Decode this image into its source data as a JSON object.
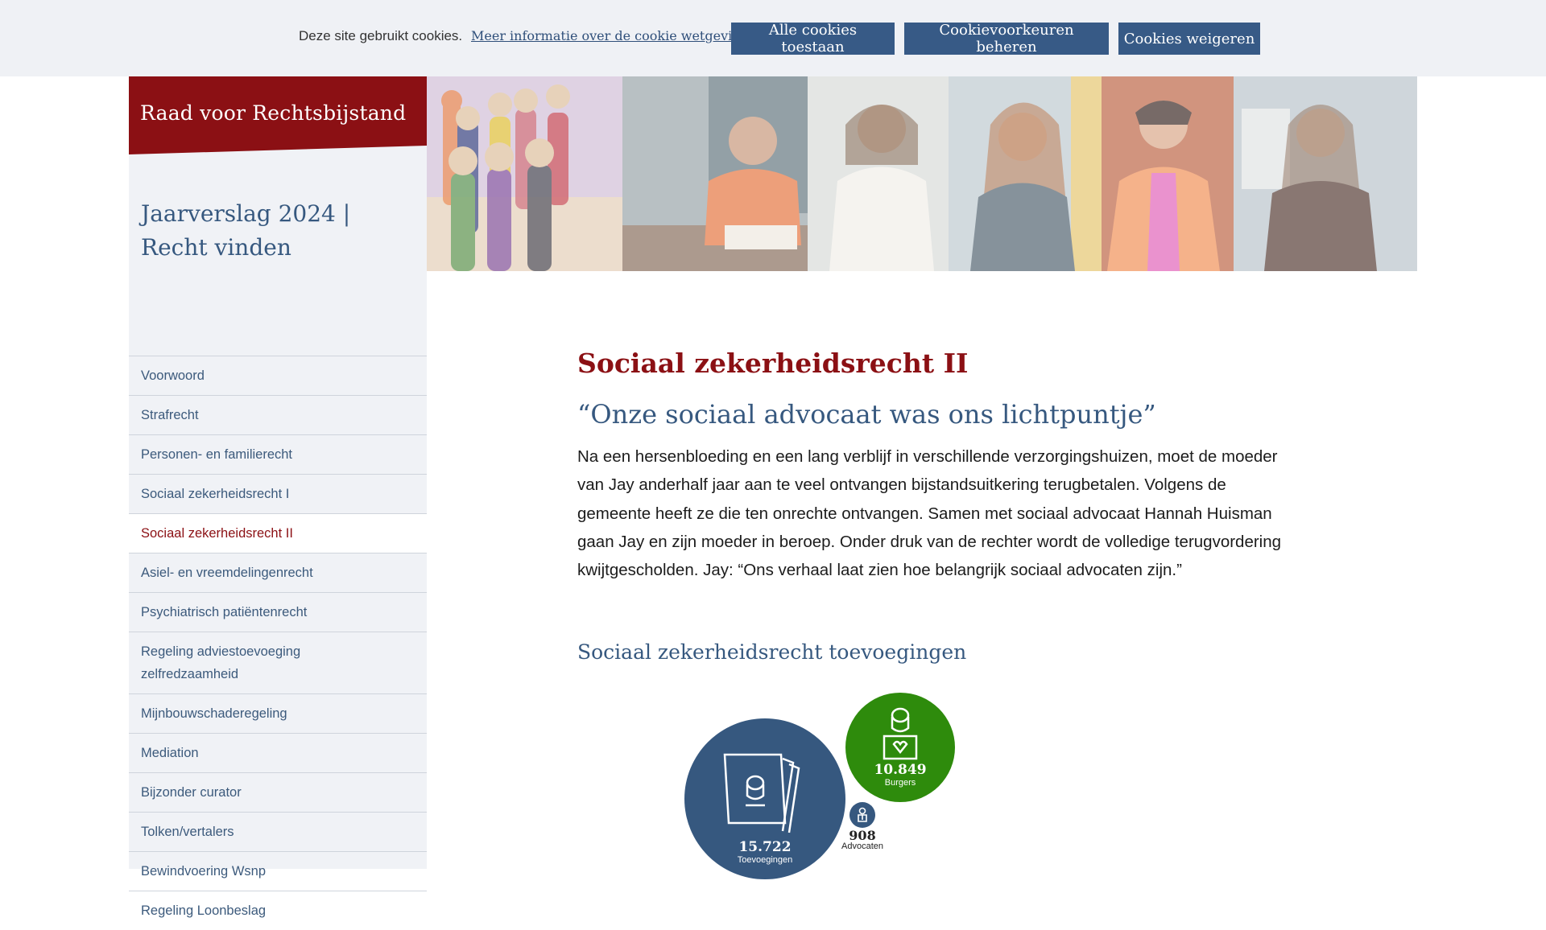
{
  "cookie": {
    "text": "Deze site gebruikt cookies.",
    "link": "Meer informatie over de cookie wetgeving",
    "accept_label": "Alle cookies toestaan",
    "manage_label": "Cookievoorkeuren beheren",
    "reject_label": "Cookies weigeren"
  },
  "site": {
    "logo": "Raad voor Rechtsbijstand",
    "report_title": "Jaarverslag 2024 | Recht vinden"
  },
  "nav": {
    "items": [
      {
        "label": "Voorwoord"
      },
      {
        "label": "Strafrecht"
      },
      {
        "label": "Personen- en familierecht"
      },
      {
        "label": "Sociaal zekerheidsrecht I"
      },
      {
        "label": "Sociaal zekerheidsrecht II"
      },
      {
        "label": "Asiel- en vreemdelingenrecht"
      },
      {
        "label": "Psychiatrisch patiëntenrecht"
      },
      {
        "label": "Regeling adviestoevoeging zelfredzaamheid"
      },
      {
        "label": "Mijnbouwschaderegeling"
      },
      {
        "label": "Mediation"
      },
      {
        "label": "Bijzonder curator"
      },
      {
        "label": "Tolken/vertalers"
      },
      {
        "label": "Bewindvoering Wsnp"
      },
      {
        "label": "Regeling Loonbeslag"
      }
    ]
  },
  "main": {
    "title": "Sociaal zekerheidsrecht II",
    "quote": "“Onze sociaal advocaat was ons lichtpuntje”",
    "intro": "Na een hersenbloeding en een lang verblijf in verschillende verzorgingshuizen, moet de moeder van Jay anderhalf jaar aan te veel ontvangen bijstandsuitkering terugbetalen. Volgens de gemeente heeft ze die ten onrechte ontvangen. Samen met sociaal advocaat Hannah Huisman gaan Jay en zijn moeder in beroep. Onder druk van de rechter wordt de volledige terugvordering kwijtgescholden. Jay: “Ons verhaal laat zien hoe belangrijk sociaal advocaten zijn.”",
    "subtitle": "Sociaal zekerheidsrecht toevoegingen"
  },
  "infographic": {
    "toevoegingen_value": "15.722",
    "toevoegingen_label": "Toevoegingen",
    "burgers_value": "10.849",
    "burgers_label": "Burgers",
    "advocaten_value": "908",
    "advocaten_label": "Advocaten"
  },
  "colors": {
    "brand_red": "#8b1014",
    "brand_blue": "#36587f",
    "green": "#2e8b0c"
  }
}
